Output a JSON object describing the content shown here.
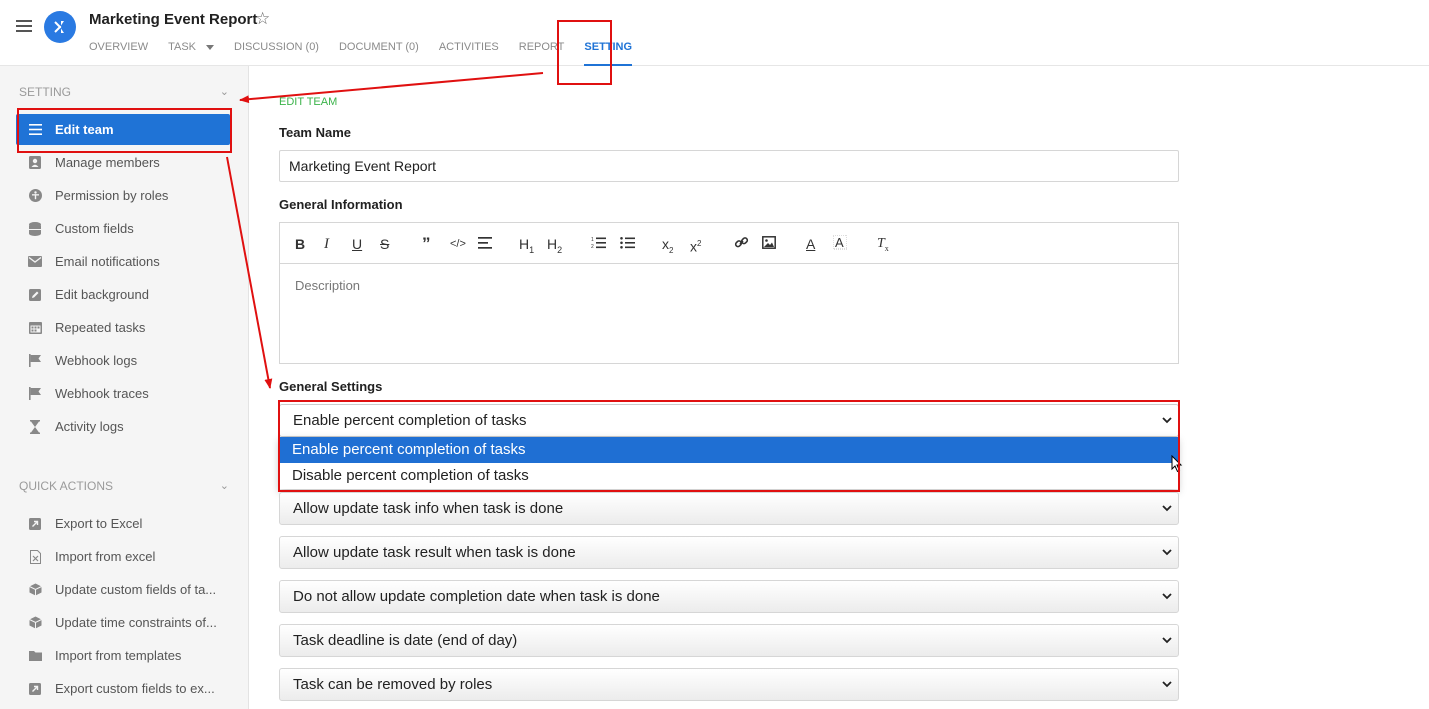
{
  "header": {
    "title": "Marketing Event Report",
    "tabs": [
      {
        "label": "OVERVIEW"
      },
      {
        "label": "TASK"
      },
      {
        "label": "DISCUSSION (0)"
      },
      {
        "label": "DOCUMENT (0)"
      },
      {
        "label": "ACTIVITIES"
      },
      {
        "label": "REPORT"
      },
      {
        "label": "SETTING",
        "active": true
      }
    ]
  },
  "sidebar": {
    "setting_title": "SETTING",
    "setting_items": [
      {
        "label": "Edit team",
        "icon": "list-icon",
        "active": true
      },
      {
        "label": "Manage members",
        "icon": "contact-icon"
      },
      {
        "label": "Permission by roles",
        "icon": "accessibility-icon"
      },
      {
        "label": "Custom fields",
        "icon": "database-icon"
      },
      {
        "label": "Email notifications",
        "icon": "mail-icon"
      },
      {
        "label": "Edit background",
        "icon": "edit-icon"
      },
      {
        "label": "Repeated tasks",
        "icon": "calendar-icon"
      },
      {
        "label": "Webhook logs",
        "icon": "flag-icon"
      },
      {
        "label": "Webhook traces",
        "icon": "flag-icon"
      },
      {
        "label": "Activity logs",
        "icon": "hourglass-icon"
      }
    ],
    "quick_title": "QUICK ACTIONS",
    "quick_items": [
      {
        "label": "Export to Excel",
        "icon": "export-icon"
      },
      {
        "label": "Import from excel",
        "icon": "excel-file-icon"
      },
      {
        "label": "Update custom fields of ta...",
        "icon": "box-icon"
      },
      {
        "label": "Update time constraints of...",
        "icon": "box-icon"
      },
      {
        "label": "Import from templates",
        "icon": "folder-icon"
      },
      {
        "label": "Export custom fields to ex...",
        "icon": "export-icon"
      }
    ]
  },
  "form": {
    "section_label": "EDIT TEAM",
    "team_name_label": "Team Name",
    "team_name_value": "Marketing Event Report",
    "general_info_label": "General Information",
    "description_placeholder": "Description",
    "general_settings_label": "General Settings",
    "settings": [
      "Enable percent completion of tasks",
      "Allow update task info when task is done",
      "Allow update task result when task is done",
      "Do not allow update completion date when task is done",
      "Task deadline is date (end of day)",
      "Task can be removed by roles"
    ],
    "dropdown_options": [
      "Enable percent completion of tasks",
      "Disable percent completion of tasks"
    ]
  },
  "colors": {
    "accent": "#1f73d6",
    "green_label": "#3bb34a",
    "highlight_red": "#e01010"
  }
}
